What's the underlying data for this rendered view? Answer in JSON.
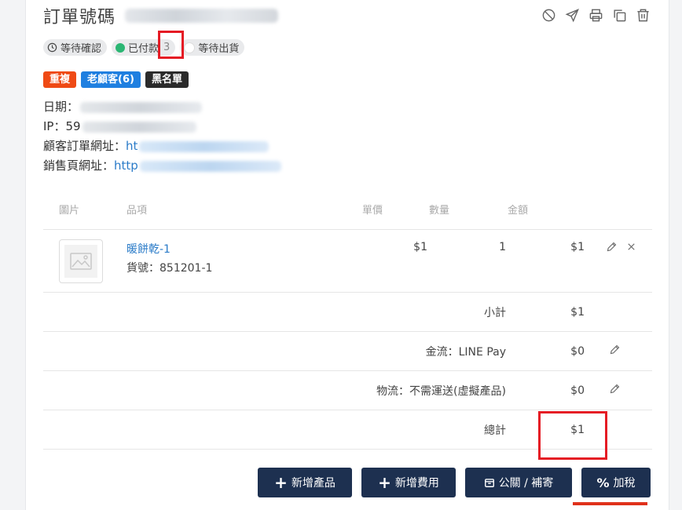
{
  "order": {
    "title": "訂單號碼"
  },
  "status": {
    "waiting_confirm": "等待確認",
    "paid": "已付款",
    "paid_count": "3",
    "waiting_ship": "等待出貨",
    "paid_dot_color": "#2bb673"
  },
  "tags": [
    {
      "label": "重複",
      "color": "#ef4a15"
    },
    {
      "label": "老顧客(6)",
      "color": "#1f7fe0"
    },
    {
      "label": "黑名單",
      "color": "#2b2b2b"
    }
  ],
  "info": {
    "date_label": "日期：",
    "ip_label": "IP：",
    "ip_prefix": "59",
    "customer_url_label": "顧客訂單網址：",
    "customer_url_prefix": "ht",
    "sales_url_label": "銷售頁網址：",
    "sales_url_prefix": "http"
  },
  "table": {
    "headers": [
      "圖片",
      "品項",
      "單價",
      "數量",
      "金額"
    ],
    "items": [
      {
        "name": "暖餅乾-1",
        "sku_label": "貨號：",
        "sku": "851201-1",
        "price": "$1",
        "qty": "1",
        "amount": "$1"
      }
    ],
    "summary": {
      "subtotal_label": "小計",
      "subtotal": "$1",
      "payment_label": "金流：LINE Pay",
      "payment": "$0",
      "shipping_label": "物流：不需運送(虛擬產品)",
      "shipping": "$0",
      "total_label": "總計",
      "total": "$1"
    }
  },
  "buttons": {
    "add_product": "新增產品",
    "add_fee": "新增費用",
    "store_pickup": "公關 / 補寄",
    "add_tax": "加稅"
  },
  "icons": {
    "actions": [
      "cancel-icon",
      "send-icon",
      "print-icon",
      "copy-icon",
      "trash-icon"
    ]
  }
}
